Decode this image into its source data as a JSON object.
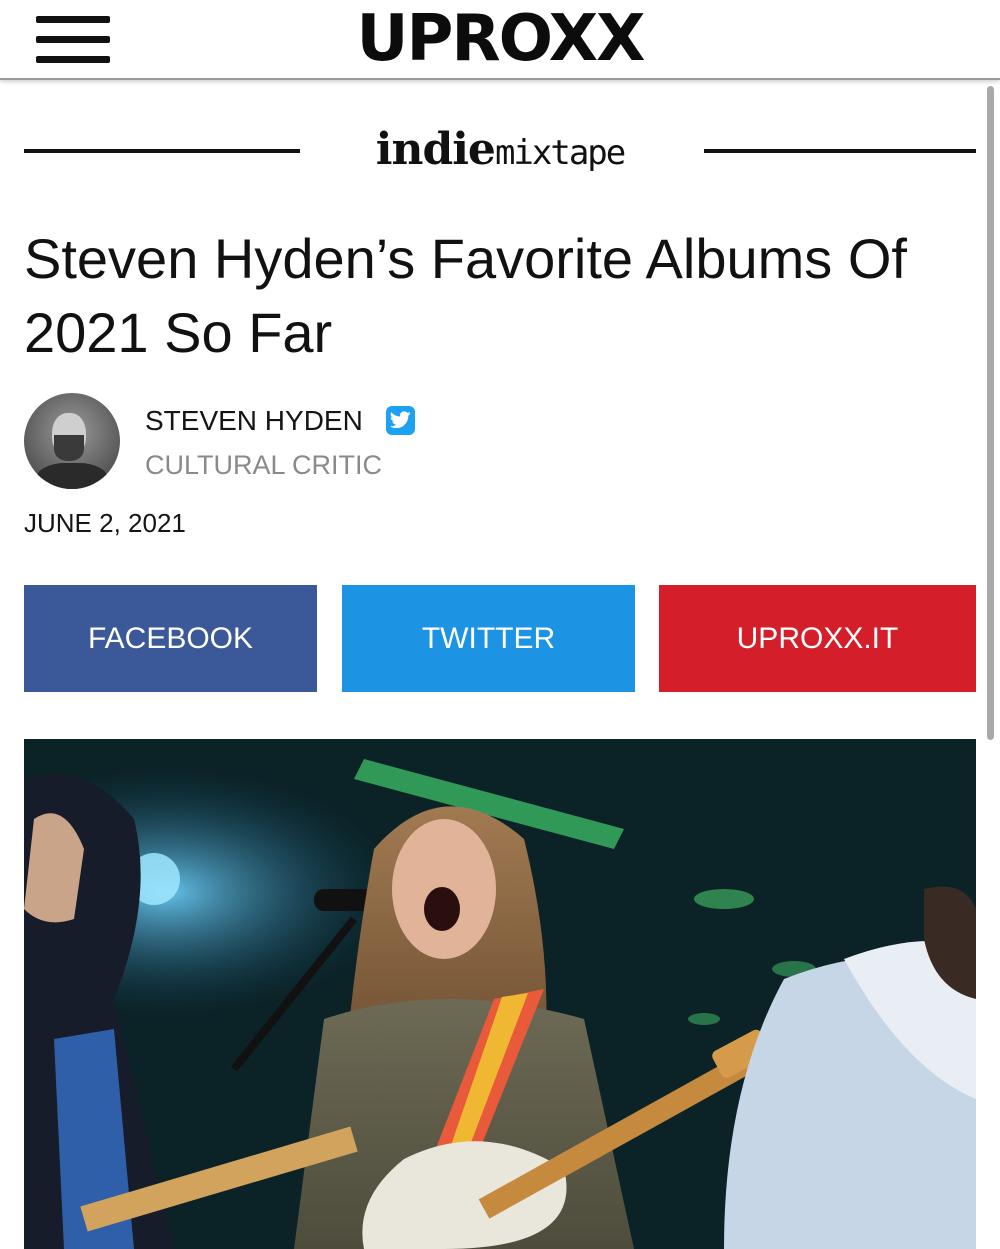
{
  "header": {
    "logo_text": "UPROXX",
    "menu_icon": "hamburger-menu-icon"
  },
  "section": {
    "name_part1": "indie",
    "name_part2": "mixtape"
  },
  "article": {
    "title": "Steven Hyden’s Favorite Albums Of 2021 So Far",
    "author_name": "STEVEN HYDEN",
    "author_role": "CULTURAL CRITIC",
    "date": "JUNE 2, 2021",
    "twitter_badge_icon": "twitter-bird-icon"
  },
  "share": {
    "facebook_label": "FACEBOOK",
    "twitter_label": "TWITTER",
    "uproxx_label": "UPROXX.IT"
  },
  "colors": {
    "facebook": "#3b5998",
    "twitter": "#1c93e3",
    "uproxx": "#d41f2a",
    "twitter_badge": "#1da1f2"
  }
}
